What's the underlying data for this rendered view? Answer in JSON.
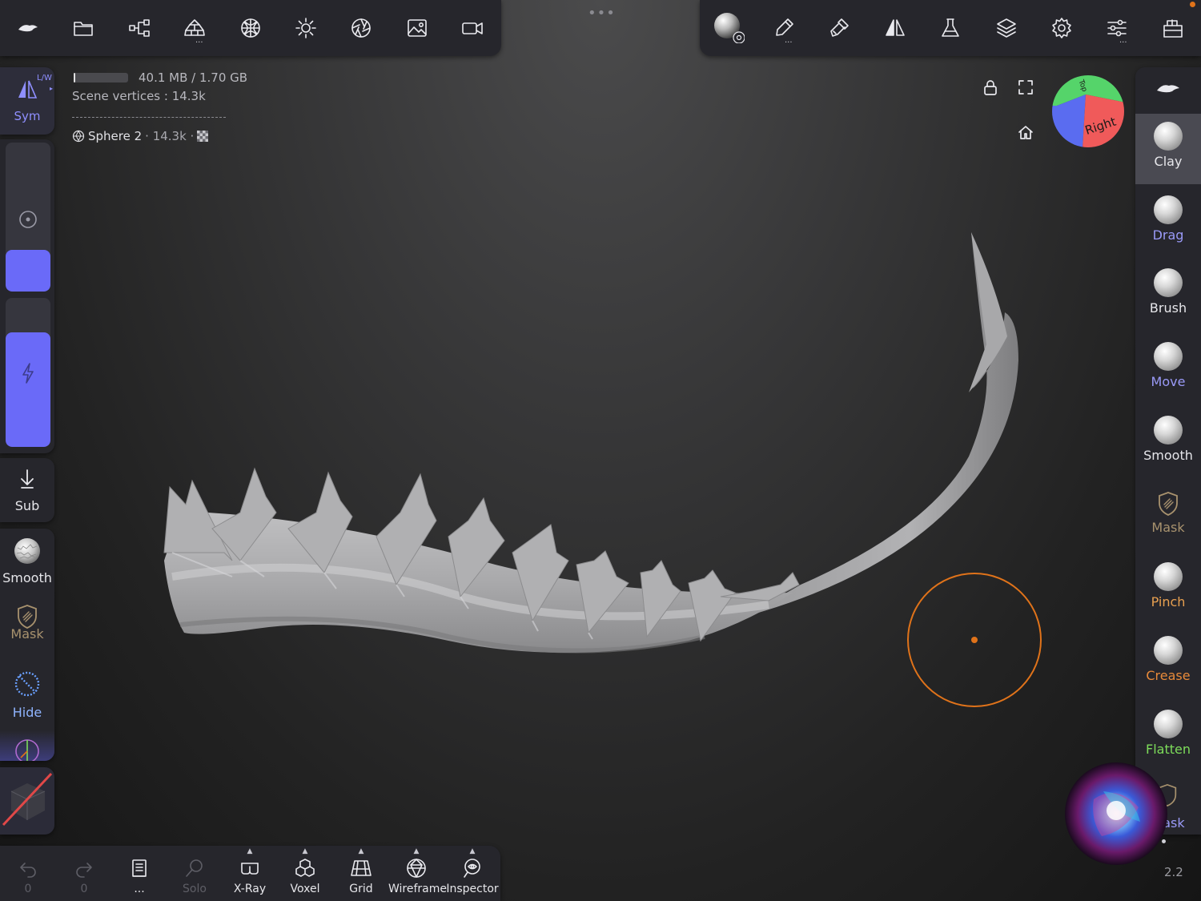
{
  "colors": {
    "accent": "#6a6af8",
    "accent_text": "#8f8fff",
    "cursor_ring": "#e0731a",
    "flatten_green": "#7ddc5a",
    "mask_tan": "#b89a72",
    "crease_orange": "#e88a3a",
    "pinch_orange": "#e8a050"
  },
  "top_left_toolbar": {
    "icons": [
      "app-logo-icon",
      "files-icon",
      "scene-tree-icon",
      "tools-icon",
      "topology-icon",
      "lighting-icon",
      "material-icon",
      "background-image-icon",
      "camera-icon"
    ]
  },
  "top_right_toolbar": {
    "icons": [
      "material-sphere-icon",
      "painting-icon",
      "stroke-icon",
      "symmetry-icon",
      "flask-icon",
      "layers-icon",
      "settings-icon",
      "sliders-icon",
      "gallery-icon"
    ]
  },
  "left_sidebar": {
    "sym_label": "Sym",
    "lw_label": "L/W",
    "radius_slider": 0.28,
    "intensity_slider": 0.77,
    "sub_label": "Sub",
    "smooth_label": "Smooth",
    "mask_label": "Mask",
    "hide_label": "Hide"
  },
  "info": {
    "memory": "40.1 MB / 1.70 GB",
    "memory_used_fraction": 0.024,
    "scene_vertices": "Scene vertices :  14.3k",
    "object_name": "Sphere 2",
    "object_vertices": "· 14.3k ·"
  },
  "gizmo": {
    "right_label": "Right",
    "top_label": "Top"
  },
  "right_sidebar": {
    "tools": [
      {
        "label": "Clay",
        "color": "#e6e6ea",
        "active": true
      },
      {
        "label": "Drag",
        "color": "#9a9af8",
        "active": false
      },
      {
        "label": "Brush",
        "color": "#e6e6ea",
        "active": false
      },
      {
        "label": "Move",
        "color": "#9a9af8",
        "active": false
      },
      {
        "label": "Smooth",
        "color": "#e6e6ea",
        "active": false
      },
      {
        "label": "Mask",
        "color": "#a8926e",
        "active": false
      },
      {
        "label": "Pinch",
        "color": "#e8a050",
        "active": false
      },
      {
        "label": "Crease",
        "color": "#e88a3a",
        "active": false
      },
      {
        "label": "Flatten",
        "color": "#7ddc5a",
        "active": false
      }
    ],
    "partial_label": "Mask"
  },
  "bottom_bar": {
    "undo_count": "0",
    "redo_count": "0",
    "more": "...",
    "solo": "Solo",
    "xray": "X-Ray",
    "voxel": "Voxel",
    "grid": "Grid",
    "wireframe": "Wireframe",
    "inspector": "Inspector"
  },
  "version": "2.2"
}
